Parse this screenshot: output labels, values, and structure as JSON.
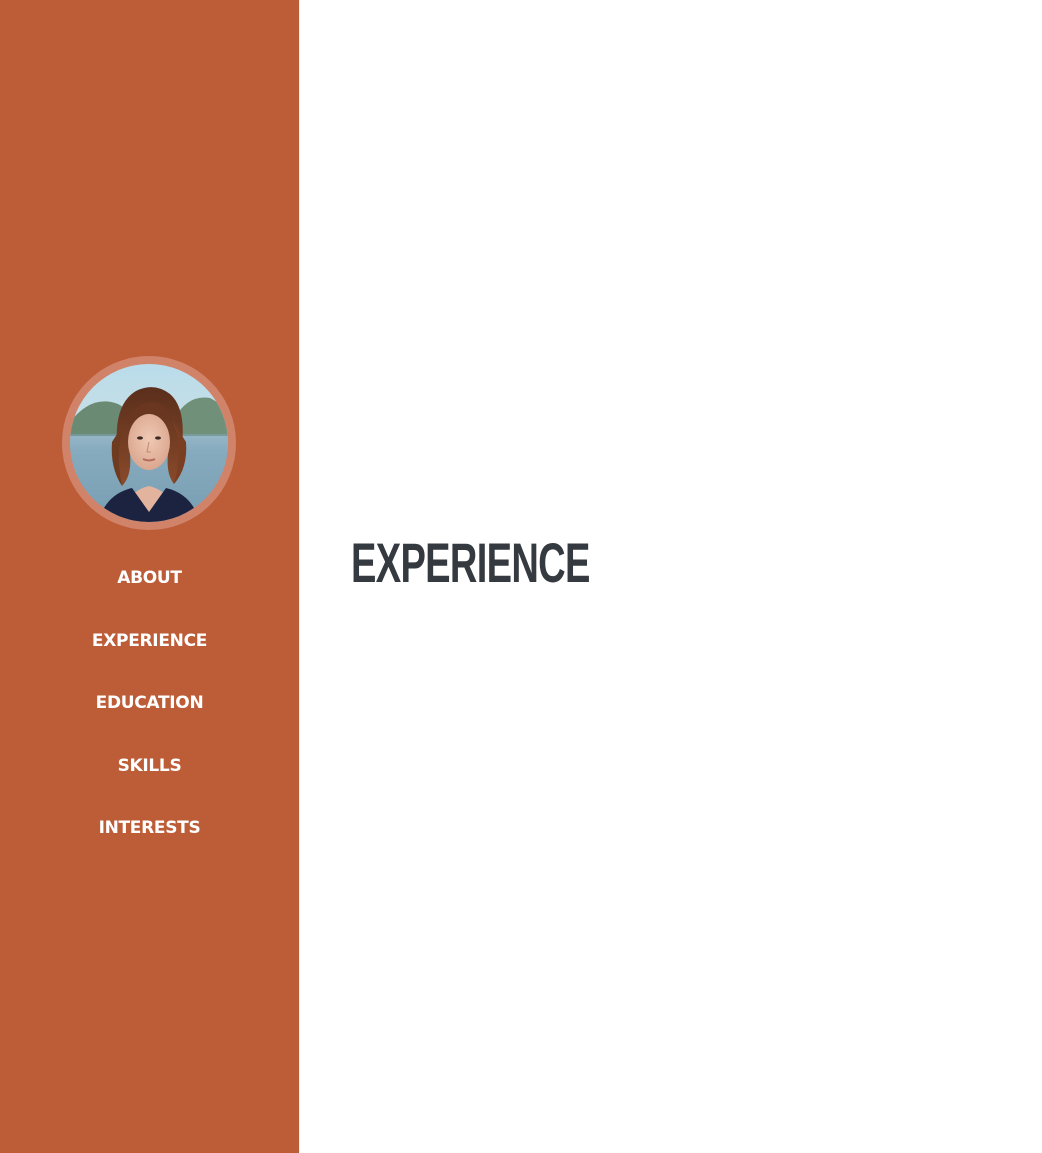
{
  "sidebar": {
    "background": "#bd5d38",
    "profile_ring_color": "#d1836a",
    "profile_image_icon": "profile-photo-woman",
    "nav": [
      {
        "label": "ABOUT"
      },
      {
        "label": "EXPERIENCE"
      },
      {
        "label": "EDUCATION"
      },
      {
        "label": "SKILLS"
      },
      {
        "label": "INTERESTS"
      }
    ]
  },
  "main": {
    "section_title": "EXPERIENCE",
    "title_color": "#343a40"
  }
}
